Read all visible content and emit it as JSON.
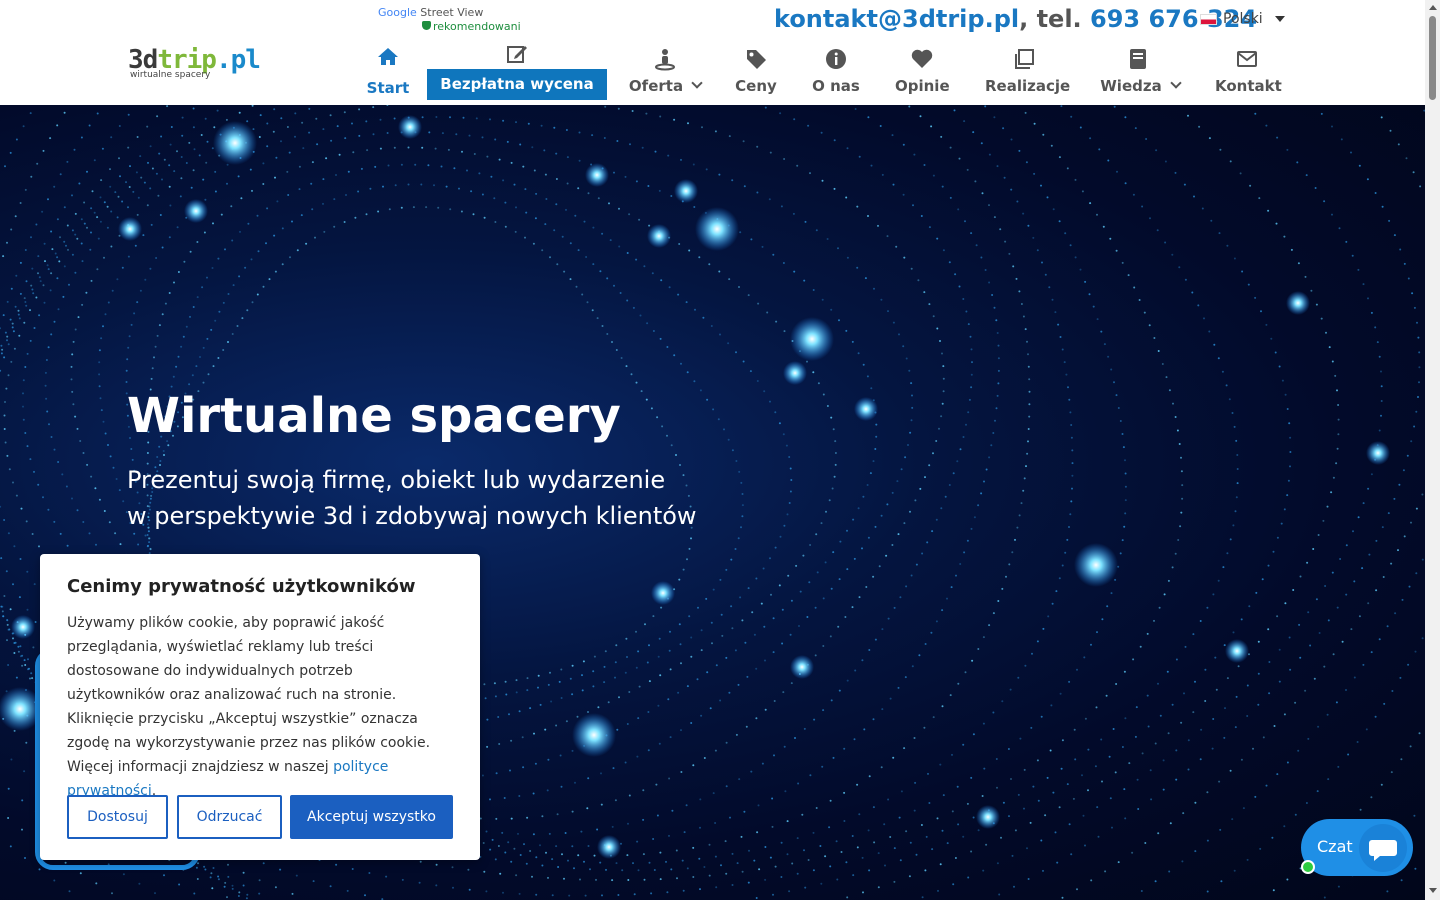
{
  "header": {
    "logo": {
      "part1": "3d",
      "part2": "trip",
      "part3": ".pl",
      "tagline": "wirtualne spacery"
    },
    "gsv_badge": {
      "brand": "Google",
      "product": " Street View",
      "badge": "rekomendowani"
    },
    "contact": {
      "email": "kontakt@3dtrip.pl",
      "separator": ", tel. ",
      "phone": "693 676 324"
    },
    "language": {
      "label": "Polski"
    }
  },
  "nav": {
    "items": [
      {
        "label": "Start",
        "icon": "home-icon"
      },
      {
        "label": "Bezpłatna wycena",
        "icon": "edit-icon"
      },
      {
        "label": "Oferta",
        "icon": "street-view-icon"
      },
      {
        "label": "Ceny",
        "icon": "tag-icon"
      },
      {
        "label": "O nas",
        "icon": "info-icon"
      },
      {
        "label": "Opinie",
        "icon": "heart-icon"
      },
      {
        "label": "Realizacje",
        "icon": "clone-icon"
      },
      {
        "label": "Wiedza",
        "icon": "book-icon"
      },
      {
        "label": "Kontakt",
        "icon": "envelope-icon"
      }
    ]
  },
  "hero": {
    "title": "Wirtualne spacery",
    "subtitle_line1": "Prezentuj swoją firmę, obiekt lub wydarzenie",
    "subtitle_line2": "w perspektywie 3d i zdobywaj nowych klientów"
  },
  "cookie": {
    "title": "Cenimy prywatność użytkowników",
    "body": "Używamy plików cookie, aby poprawić jakość przeglądania, wyświetlać reklamy lub treści dostosowane do indywidualnych potrzeb użytkowników oraz analizować ruch na stronie. Kliknięcie przycisku „Akceptuj wszystkie” oznacza zgodę na wykorzystywanie przez nas plików cookie. Więcej informacji znajdziesz w naszej ",
    "link": "polityce prywatności",
    "body_end": ".",
    "btn_customize": "Dostosuj",
    "btn_reject": "Odrzucać",
    "btn_accept": "Akceptuj wszystko"
  },
  "chat": {
    "label": "Czat"
  },
  "colors": {
    "brand_blue": "#1a78c2",
    "cta_blue": "#0f76bd",
    "chat_blue": "#1f8fe6",
    "cookie_blue": "#1b5fc0"
  }
}
